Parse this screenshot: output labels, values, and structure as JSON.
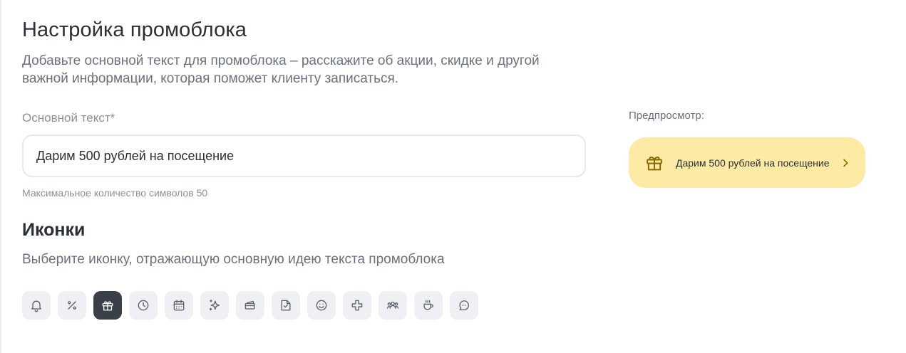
{
  "promo": {
    "title": "Настройка промоблока",
    "subtitle": "Добавьте основной текст для промоблока – расскажите об акции, скидке и другой важной информации, которая поможет клиенту записаться.",
    "main_text_label": "Основной текст*",
    "main_text_value": "Дарим 500 рублей на посещение",
    "hint": "Максимальное количество символов 50"
  },
  "icons": {
    "title": "Иконки",
    "subtitle": "Выберите иконку, отражающую основную идею текста промоблока",
    "selected": "gift-icon",
    "items": [
      "bell-icon",
      "percent-icon",
      "gift-icon",
      "clock-icon",
      "calendar-icon",
      "sparkles-icon",
      "cards-icon",
      "ticket-icon",
      "smile-icon",
      "plus-icon",
      "people-icon",
      "coffee-icon",
      "chat-icon"
    ]
  },
  "preview": {
    "label": "Предпросмотр:",
    "text": "Дарим 500 рублей на посещение",
    "icon": "gift-icon",
    "background_color": "#fdeba5",
    "accent_color": "#8a6a00"
  },
  "colors": {
    "selected_icon_bg": "#3b3f47",
    "icon_bg": "#eef0f4"
  }
}
